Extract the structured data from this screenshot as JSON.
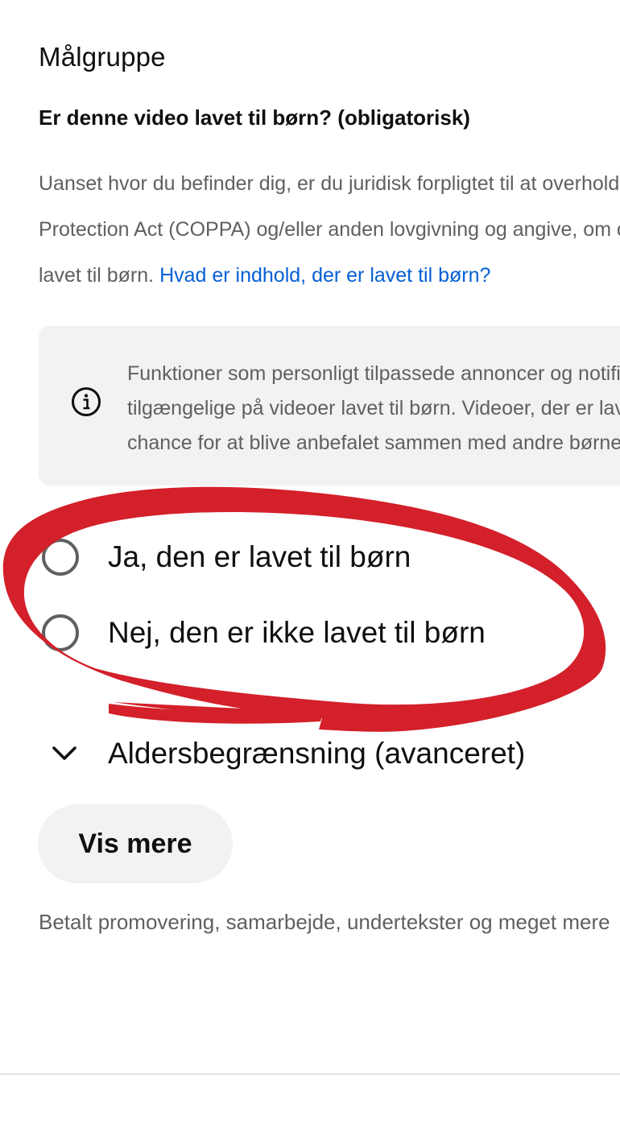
{
  "section": {
    "title": "Målgruppe"
  },
  "question": {
    "text": "Er denne video lavet til børn? (obligatorisk)"
  },
  "description": {
    "line1": "Uanset hvor du befinder dig, er du juridisk forpligtet til at overholde Children's Online Privacy",
    "line2": "Protection Act (COPPA) og/eller anden lovgivning og angive, om dine videoer er",
    "line3_prefix": "lavet til børn. ",
    "link_text": "Hvad er indhold, der er lavet til børn?"
  },
  "info_box": {
    "icon": "info-icon",
    "line1": "Funktioner som personligt tilpassede annoncer og notifikationer vil ikke være",
    "line2": "tilgængelige på videoer lavet til børn. Videoer, der er lavet til børn, har større",
    "line3": "chance for at blive anbefalet sammen med andre børnevideoer."
  },
  "audience_options": [
    {
      "label": "Ja, den er lavet til børn",
      "selected": false
    },
    {
      "label": "Nej, den er ikke lavet til børn",
      "selected": false
    }
  ],
  "age_restriction": {
    "icon": "chevron-down-icon",
    "label": "Aldersbegrænsning (avanceret)"
  },
  "show_more": {
    "label": "Vis mere"
  },
  "footer": {
    "text": "Betalt promovering, samarbejde, undertekster og meget mere"
  },
  "colors": {
    "link": "#065fd4",
    "annotation_red": "#d3202a",
    "text_primary": "#0f0f0f",
    "text_secondary": "#606060",
    "surface": "#f2f2f2"
  }
}
